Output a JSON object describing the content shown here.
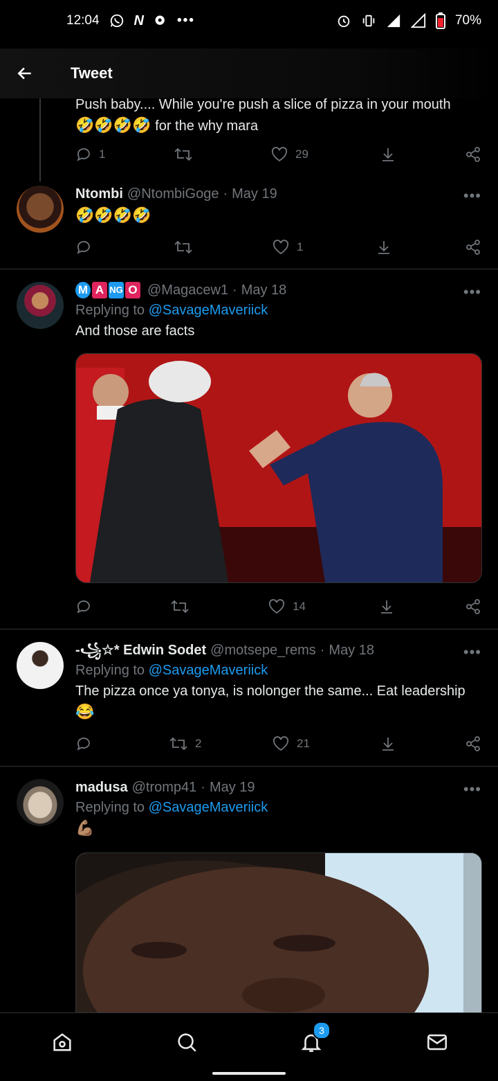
{
  "status_bar": {
    "time": "12:04",
    "battery": "70%",
    "icons": [
      "whatsapp-icon",
      "netflix-icon",
      "chat-icon",
      "more-dots-icon",
      "alarm-icon",
      "vibrate-icon",
      "signal-icon",
      "lte-icon",
      "battery-icon"
    ]
  },
  "header": {
    "title": "Tweet"
  },
  "tweets": [
    {
      "text_line1": "Push baby.... While you're push a slice of pizza in your mouth",
      "text_line2_emoji": "🤣🤣🤣🤣",
      "text_line2": "for the why mara",
      "reply_count": "1",
      "like_count": "29"
    },
    {
      "name": "Ntombi",
      "handle": "@NtombiGoge",
      "dot": "·",
      "date": "May 19",
      "text": "🤣🤣🤣🤣",
      "like_count": "1"
    },
    {
      "name_letters": [
        "M",
        "A",
        "NG",
        "O"
      ],
      "handle": "@Magacew1",
      "dot": "·",
      "date": "May 18",
      "replying_label": "Replying to",
      "replying_to": "@SavageMaveriick",
      "text": "And those are facts",
      "like_count": "14"
    },
    {
      "name": "-꧁☆* Edwin Sodet",
      "handle": "@motsepe_rems",
      "dot": "·",
      "date": "May 18",
      "replying_label": "Replying to",
      "replying_to": "@SavageMaveriick",
      "text": "The pizza once ya tonya, is nolonger the same... Eat leadership",
      "emoji": "😂",
      "retweet_count": "2",
      "like_count": "21"
    },
    {
      "name": "madusa",
      "handle": "@tromp41",
      "dot": "·",
      "date": "May 19",
      "replying_label": "Replying to",
      "replying_to": "@SavageMaveriick",
      "emoji": "💪🏽"
    }
  ],
  "more_label": "•••",
  "bottom_nav": {
    "notifications_badge": "3"
  },
  "colors": {
    "accent": "#1d9bf0",
    "background": "#000000",
    "muted": "#71767b",
    "divider": "#2f3336"
  }
}
